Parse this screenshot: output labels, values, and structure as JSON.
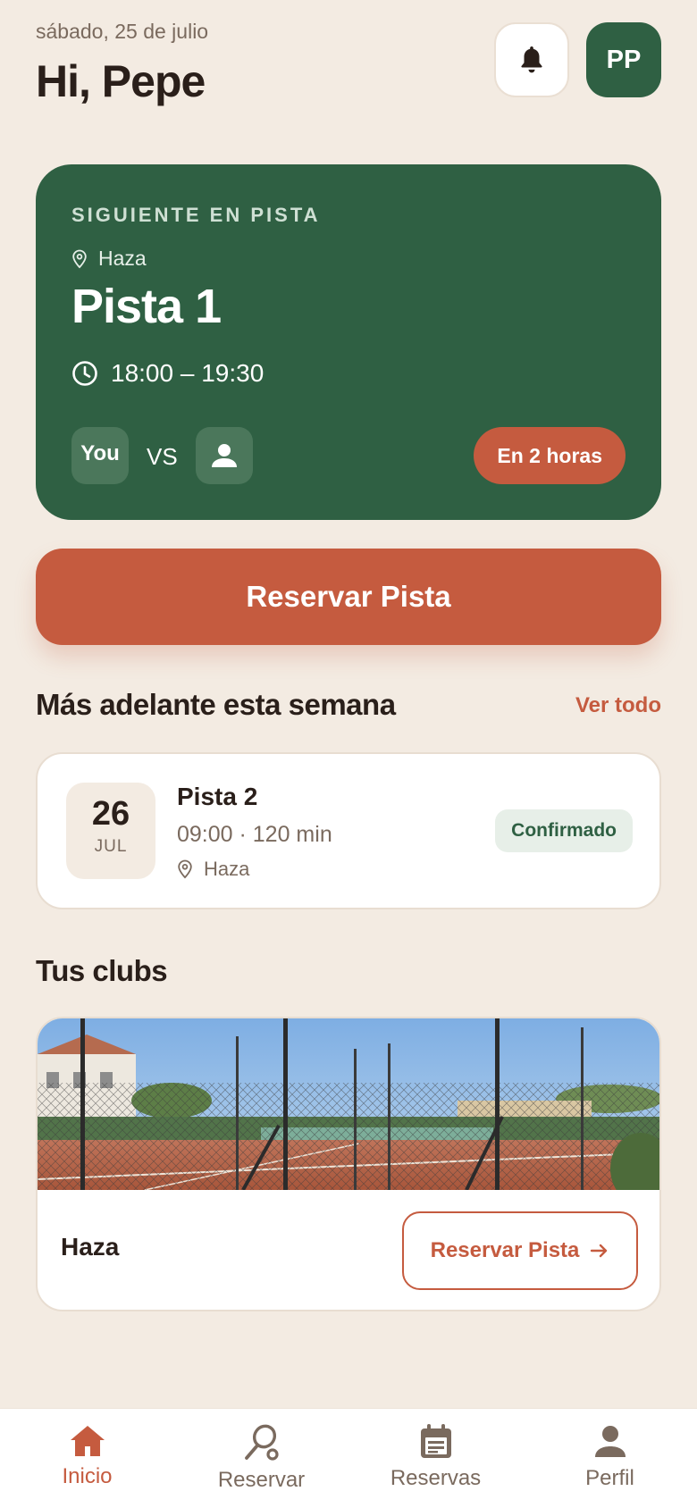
{
  "header": {
    "date": "sábado, 25 de julio",
    "greeting": "Hi, Pepe",
    "avatar_initials": "PP",
    "bell_icon": "bell-icon"
  },
  "next_match": {
    "eyebrow": "SIGUIENTE EN PISTA",
    "club": "Haza",
    "court": "Pista 1",
    "time": "18:00 – 19:30",
    "player_you": "You",
    "vs": "VS",
    "countdown": "En 2 horas"
  },
  "primary_action": {
    "label": "Reservar Pista"
  },
  "upcoming": {
    "title": "Más adelante esta semana",
    "see_all": "Ver todo",
    "bookings": [
      {
        "day": "26",
        "month": "JUL",
        "court": "Pista 2",
        "meta": "09:00 · 120 min",
        "club": "Haza",
        "status": "Confirmado"
      }
    ]
  },
  "clubs": {
    "title": "Tus clubs",
    "items": [
      {
        "name": "Haza",
        "action": "Reservar Pista"
      }
    ]
  },
  "tabbar": {
    "items": [
      {
        "label": "Inicio",
        "icon": "home-icon",
        "active": true
      },
      {
        "label": "Reservar",
        "icon": "racket-icon",
        "active": false
      },
      {
        "label": "Reservas",
        "icon": "calendar-icon",
        "active": false
      },
      {
        "label": "Perfil",
        "icon": "person-icon",
        "active": false
      }
    ]
  },
  "colors": {
    "background": "#f3ebe2",
    "primary_green": "#2f6043",
    "accent_terracotta": "#c55b3f",
    "text_dark": "#2a1f1a",
    "text_muted": "#7a6a5e"
  }
}
